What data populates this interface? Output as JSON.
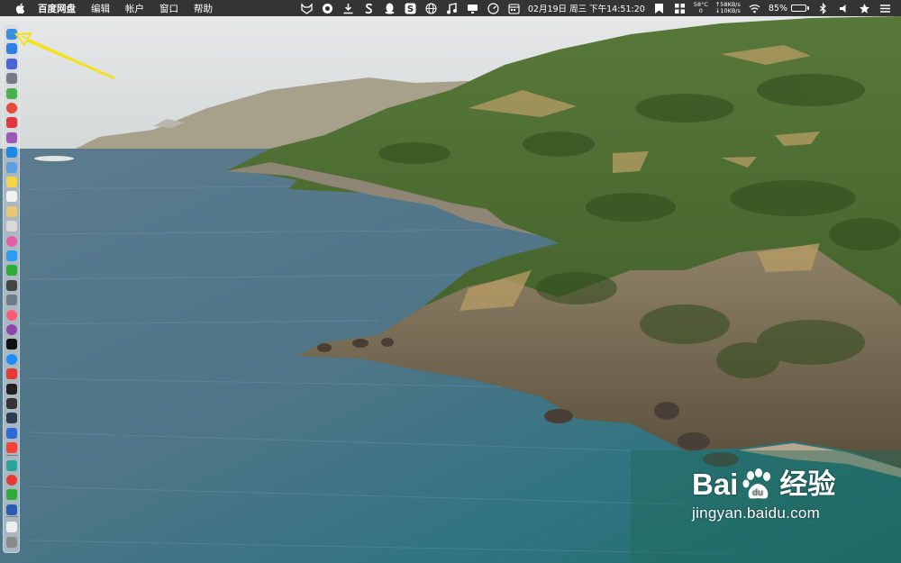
{
  "menubar": {
    "apple_icon": "apple-icon",
    "app_name": "百度网盘",
    "menus": [
      "编辑",
      "帐户",
      "窗口",
      "帮助"
    ],
    "status": {
      "date": "02月19日",
      "weekday": "周三",
      "time": "下午14:51:20",
      "temp": "58°C",
      "temp_sub": "0",
      "net_up": "↑58KB/s",
      "net_down": "↓10KB/s",
      "battery": "85%",
      "battery_level": 0.85
    }
  },
  "dock": {
    "items": [
      "finder-icon",
      "safari-icon",
      "launchpad-icon",
      "rocket-icon",
      "android-icon",
      "chrome-icon",
      "app-red-icon",
      "app-purple-icon",
      "appstore-icon",
      "preview-icon",
      "notes-icon",
      "calendar-icon",
      "stickies-icon",
      "photos-icon",
      "colorwheel-icon",
      "messages-icon",
      "wechat-icon",
      "camera-icon",
      "downloads-icon",
      "music-icon",
      "podcasts-icon",
      "appletv-icon",
      "appstore2-icon",
      "vivaldi-icon",
      "terminal-icon",
      "terminal2-icon",
      "console-icon",
      "vpn-icon",
      "yandex-icon",
      "app-teal-icon",
      "app-target-icon",
      "wechat2-icon",
      "settings-icon",
      "document-icon",
      "trash-icon"
    ],
    "colors": [
      "#3b8fe0",
      "#2f7fe8",
      "#4864d6",
      "#777b85",
      "#4caf50",
      "#e64a3a",
      "#e5383b",
      "#9b59b6",
      "#1e88e5",
      "#5c9ee0",
      "#f5d547",
      "#f2f2f2",
      "#e8c872",
      "#d9d9d9",
      "#e65da8",
      "#2d9cf0",
      "#2eaa38",
      "#444444",
      "#6c7a8a",
      "#fa5c78",
      "#8e44ad",
      "#111111",
      "#1a8cff",
      "#e53935",
      "#222222",
      "#333333",
      "#2c3e50",
      "#2d6cd6",
      "#f44336",
      "#26a69a",
      "#e53935",
      "#2eaa38",
      "#2a5db0",
      "#eeeeee",
      "#8a8a8a"
    ]
  },
  "watermark": {
    "brand_a": "Bai",
    "brand_b": "du",
    "jingyan": "经验",
    "url": "jingyan.baidu.com"
  }
}
